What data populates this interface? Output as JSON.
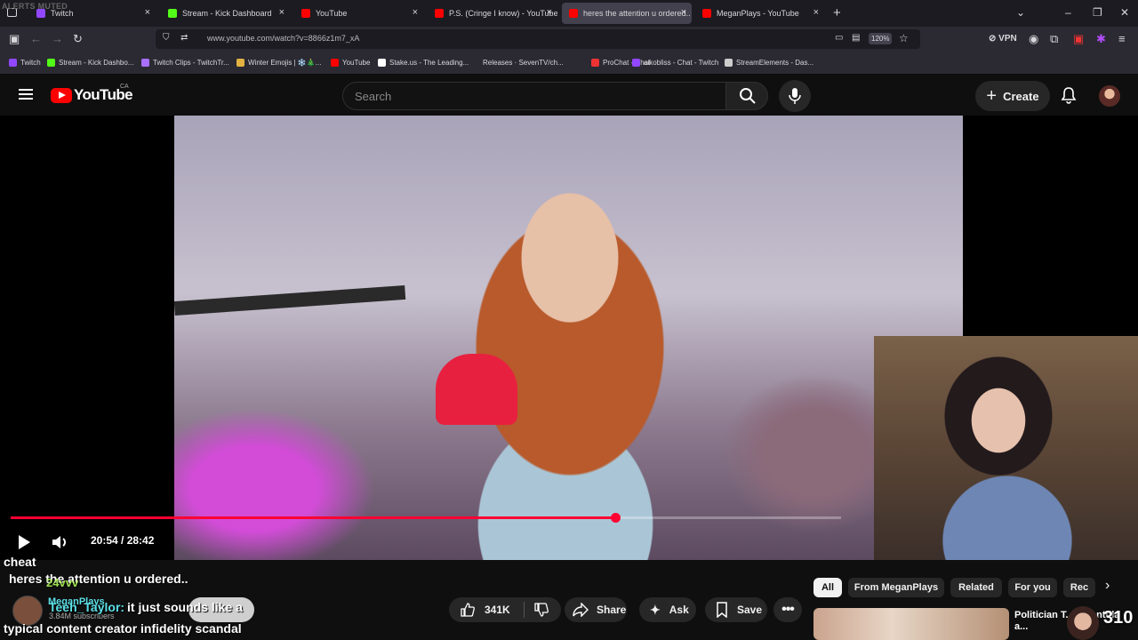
{
  "overlay": {
    "alerts_text": "ALERTS MUTED",
    "right_number": "310"
  },
  "browser": {
    "tabs": [
      {
        "label": "Twitch",
        "fav": "#9147ff",
        "active": false
      },
      {
        "label": "Stream - Kick Dashboard",
        "fav": "#53fc18",
        "active": false
      },
      {
        "label": "YouTube",
        "fav": "#ff0000",
        "active": false
      },
      {
        "label": "P.S. (Cringe I know) - YouTube",
        "fav": "#ff0000",
        "active": false
      },
      {
        "label": "heres the attention u ordered..",
        "fav": "#ff0000",
        "active": true
      },
      {
        "label": "MeganPlays - YouTube",
        "fav": "#ff0000",
        "active": false
      }
    ],
    "url": "www.youtube.com/watch?v=8866z1m7_xA",
    "zoom": "120%",
    "vpn_label": "VPN",
    "bookmarks": [
      {
        "label": "Twitch",
        "fav": "#9147ff"
      },
      {
        "label": "Stream - Kick Dashbo...",
        "fav": "#53fc18"
      },
      {
        "label": "Twitch Clips - TwitchTr...",
        "fav": "#a970ff"
      },
      {
        "label": "Winter Emojis | ❄️🎄...",
        "fav": "#e3b341"
      },
      {
        "label": "YouTube",
        "fav": "#ff0000"
      },
      {
        "label": "Stake.us - The Leading...",
        "fav": "#ffffff"
      },
      {
        "label": "Releases · SevenTV/ch...",
        "fav": "#2b2a33"
      },
      {
        "label": "ProChat - Chat",
        "fav": "#e33"
      },
      {
        "label": "aikobliss - Chat - Twitch",
        "fav": "#9147ff"
      },
      {
        "label": "StreamElements - Das...",
        "fav": "#ccc"
      }
    ]
  },
  "youtube": {
    "logo_text": "YouTube",
    "country": "CA",
    "search_placeholder": "Search",
    "create_label": "Create",
    "player": {
      "current_time": "20:54",
      "duration": "28:42",
      "time_display": "20:54 / 28:42",
      "progress_fraction": 0.728
    },
    "actions": {
      "like_count": "341K",
      "share_label": "Share",
      "ask_label": "Ask",
      "save_label": "Save"
    },
    "chips": [
      "All",
      "From MeganPlays",
      "Related",
      "For you",
      "Rec"
    ],
    "rec_title": "Politician T... Tarantula a...",
    "channel_subs": "3.84M subscribers"
  },
  "chat": {
    "line1": "cheat",
    "line2": "heres the attention u ordered..",
    "line3_user": "24vvv",
    "line4_user": "Teeh_Taylor:",
    "line4_text": "it just sounds like a",
    "line5": "typical content creator infidelity scandal",
    "channel_name": "MeganPlays"
  }
}
